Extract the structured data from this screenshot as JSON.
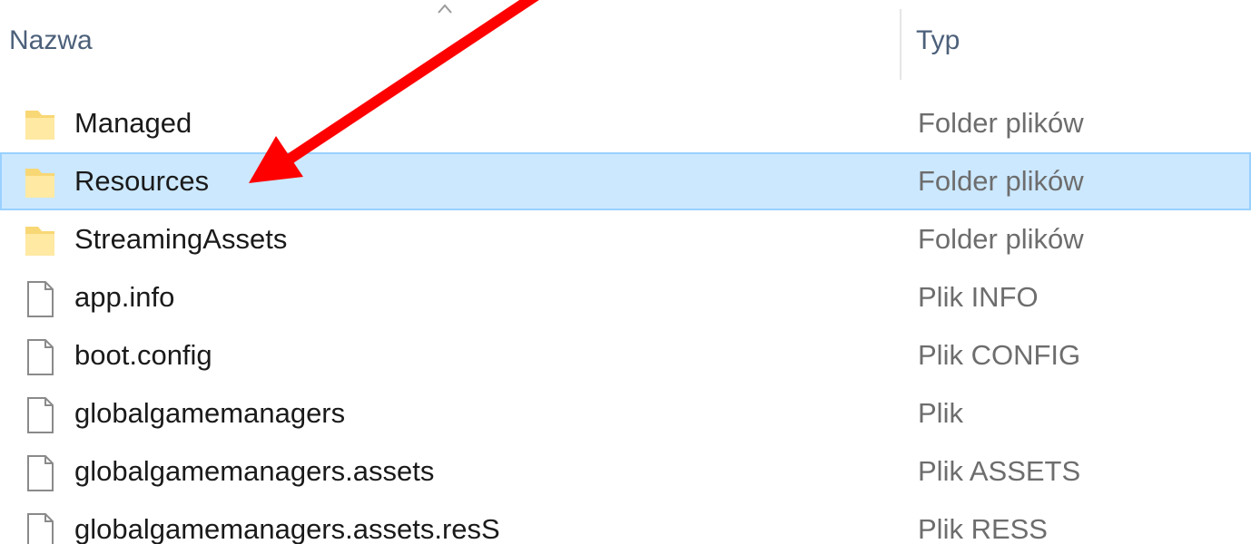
{
  "header": {
    "name_label": "Nazwa",
    "type_label": "Typ"
  },
  "rows": [
    {
      "name": "Managed",
      "type": "Folder plików",
      "icon": "folder-icon",
      "selected": false
    },
    {
      "name": "Resources",
      "type": "Folder plików",
      "icon": "folder-icon",
      "selected": true
    },
    {
      "name": "StreamingAssets",
      "type": "Folder plików",
      "icon": "folder-icon",
      "selected": false
    },
    {
      "name": "app.info",
      "type": "Plik INFO",
      "icon": "file-icon",
      "selected": false
    },
    {
      "name": "boot.config",
      "type": "Plik CONFIG",
      "icon": "file-icon",
      "selected": false
    },
    {
      "name": "globalgamemanagers",
      "type": "Plik",
      "icon": "file-icon",
      "selected": false
    },
    {
      "name": "globalgamemanagers.assets",
      "type": "Plik ASSETS",
      "icon": "file-icon",
      "selected": false
    },
    {
      "name": "globalgamemanagers.assets.resS",
      "type": "Plik RESS",
      "icon": "file-icon",
      "selected": false
    }
  ],
  "colors": {
    "selection_bg": "#cce8ff",
    "selection_border": "#99d1ff",
    "folder": "#f8d775",
    "annotation_arrow": "#ff0000"
  }
}
